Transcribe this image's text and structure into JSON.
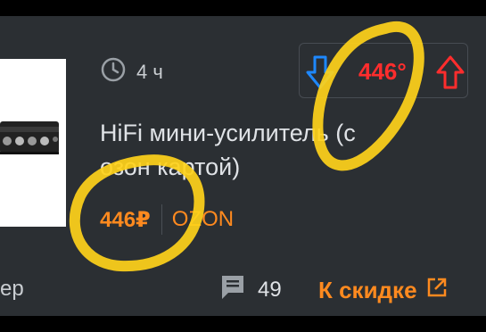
{
  "deal": {
    "time_ago": "4 ч",
    "title": "HiFi мини-усилитель (с озон картой)",
    "price": "446₽",
    "merchant": "OZON",
    "temperature": "446°",
    "comments_count": "49",
    "go_to_deal_label": "К скидке"
  },
  "left_partial_text": "ер",
  "icons": {
    "time": "clock-icon",
    "vote_down": "arrow-down-icon",
    "vote_up": "arrow-up-icon",
    "comments": "comment-bubble-icon",
    "external_link": "external-link-icon"
  },
  "colors": {
    "card_background": "#2b2f33",
    "accent_orange": "#ff8a1f",
    "temperature_red": "#ff2d2d",
    "vote_down_blue": "#1e88ff",
    "highlight_yellow": "#ffd21a"
  }
}
